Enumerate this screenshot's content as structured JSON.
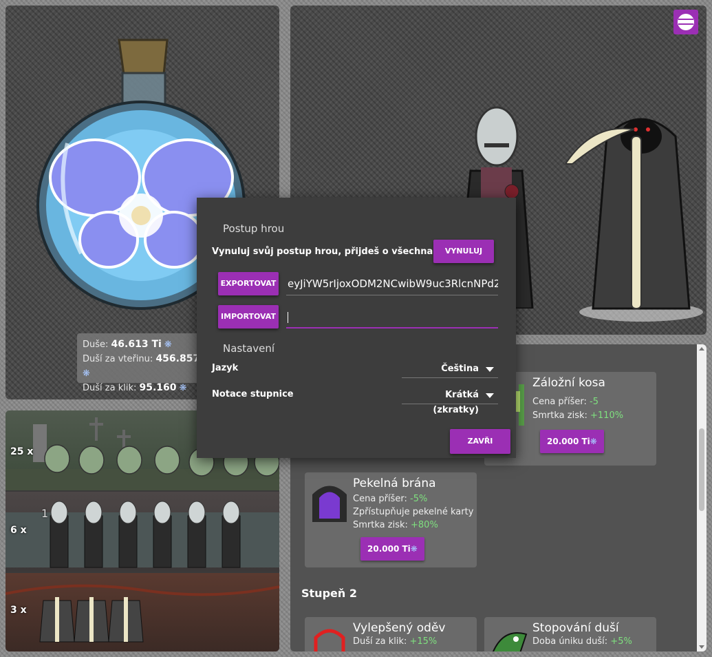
{
  "stats": {
    "souls_label": "Duše:",
    "souls_value": "46.613 Ti",
    "per_second_label": "Duší za vteřinu:",
    "per_second_value": "456.857",
    "per_click_label": "Duší za klik:",
    "per_click_value": "95.160"
  },
  "army": {
    "rows": [
      {
        "count": "25 x"
      },
      {
        "count": "6 x",
        "floating": "1"
      },
      {
        "count": "3 x"
      }
    ]
  },
  "shop": {
    "cards": [
      {
        "title": "Záložní kosa",
        "lines": [
          {
            "label": "Cena příšer:",
            "value": "-5"
          },
          {
            "label": "Smrtka zisk:",
            "value": "+110%"
          }
        ],
        "price": "20.000 Ti"
      },
      {
        "title": "Pekelná brána",
        "lines": [
          {
            "label": "Cena příšer:",
            "value": "-5%"
          },
          {
            "label": "Zpřístupňuje pekelné karty",
            "value": ""
          },
          {
            "label": "Smrtka zisk:",
            "value": "+80%"
          }
        ],
        "price": "20.000 Ti"
      },
      {
        "title": "Vylepšený oděv",
        "lines": [
          {
            "label": "Duší za klik:",
            "value": "+15%"
          }
        ]
      },
      {
        "title": "Stopování duší",
        "lines": [
          {
            "label": "Doba úniku duší:",
            "value": "+5%"
          }
        ]
      }
    ],
    "tier2_heading": "Stupeň 2"
  },
  "dialog": {
    "progress_heading": "Postup hrou",
    "reset_text": "Vynuluj svůj postup hrou, přijdeš o všechna data!",
    "reset_button": "VYNULUJ",
    "export_button": "EXPORTOVAT",
    "export_value": "eyJiYW5rIjoxODM2NCwibW9uc3RlcnNPd2",
    "import_button": "IMPORTOVAT",
    "import_value": "",
    "settings_heading": "Nastavení",
    "language_label": "Jazyk",
    "language_value": "Čeština",
    "notation_label": "Notace stupnice",
    "notation_value": "Krátká (zkratky)",
    "close_button": "ZAVŘI"
  },
  "colors": {
    "accent": "#9b2fb4",
    "positive": "#7fe07f"
  }
}
